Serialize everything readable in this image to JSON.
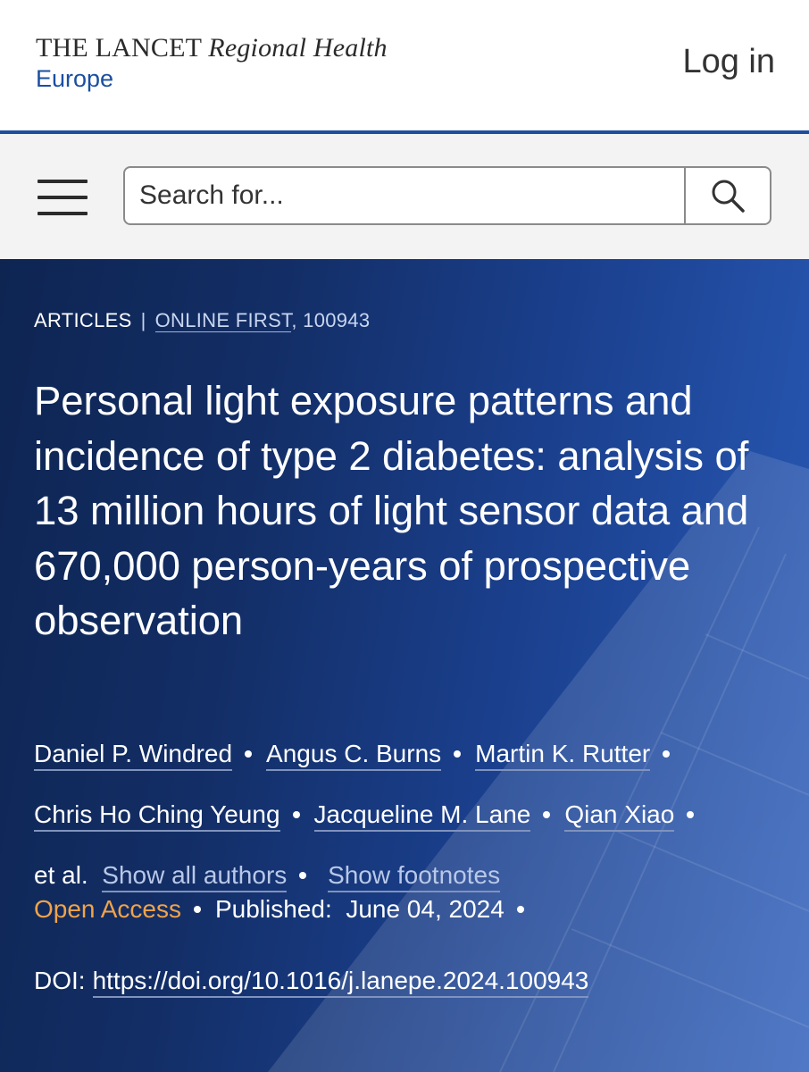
{
  "header": {
    "brand": {
      "line1_caps": "THE LANCET",
      "line1_italic": "Regional Health",
      "line2": "Europe"
    },
    "login_label": "Log in"
  },
  "search": {
    "placeholder": "Search for..."
  },
  "article": {
    "breadcrumb": {
      "section": "ARTICLES",
      "issue_link": "ONLINE FIRST",
      "article_number": ", 100943"
    },
    "title": "Personal light exposure patterns and incidence of type 2 diabetes: analysis of 13 million hours of light sensor data and 670,000 person-years of prospective observation",
    "authors": [
      "Daniel P. Windred",
      "Angus C. Burns",
      "Martin K. Rutter",
      "Chris Ho Ching Yeung",
      "Jacqueline M. Lane",
      "Qian Xiao"
    ],
    "et_al": "et al.",
    "show_all_authors": "Show all authors",
    "show_footnotes": "Show footnotes",
    "open_access": "Open Access",
    "published_label": "Published:",
    "published_date": "June 04, 2024",
    "doi_label": "DOI:",
    "doi_url": "https://doi.org/10.1016/j.lanepe.2024.100943"
  },
  "colors": {
    "brand_blue": "#1e4f9e",
    "open_access_orange": "#f0a34a",
    "hero_dark": "#0e2552",
    "hero_light": "#2a5bb8"
  },
  "icons": {
    "menu": "hamburger-menu-icon",
    "search": "magnifier-icon"
  }
}
